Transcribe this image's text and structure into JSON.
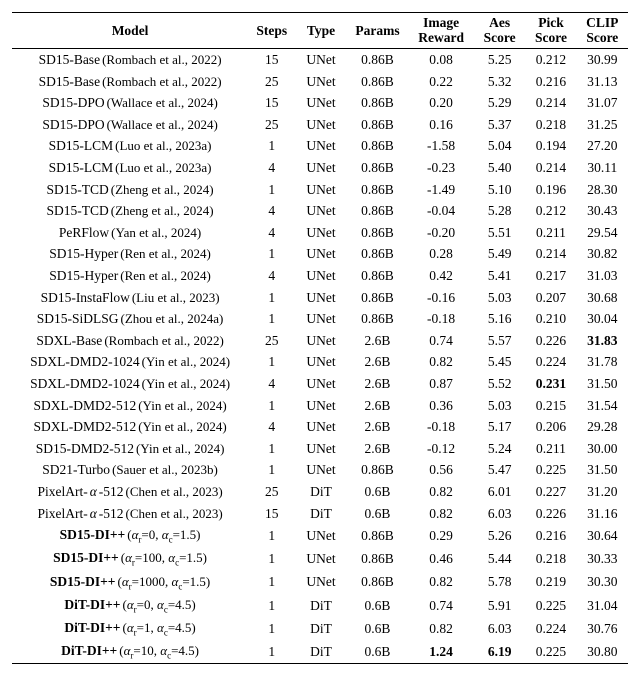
{
  "chart_data": {
    "type": "table",
    "columns": [
      "Model",
      "Steps",
      "Type",
      "Params",
      "Image Reward",
      "Aes Score",
      "Pick Score",
      "CLIP Score"
    ],
    "rows": [
      {
        "model": "SD15-Base",
        "cite": "(Rombach et al., 2022)",
        "steps": "15",
        "arch": "UNet",
        "params": "0.86B",
        "ir": "0.08",
        "aes": "5.25",
        "pick": "0.212",
        "clip": "30.99"
      },
      {
        "model": "SD15-Base",
        "cite": "(Rombach et al., 2022)",
        "steps": "25",
        "arch": "UNet",
        "params": "0.86B",
        "ir": "0.22",
        "aes": "5.32",
        "pick": "0.216",
        "clip": "31.13"
      },
      {
        "model": "SD15-DPO",
        "cite": "(Wallace et al., 2024)",
        "steps": "15",
        "arch": "UNet",
        "params": "0.86B",
        "ir": "0.20",
        "aes": "5.29",
        "pick": "0.214",
        "clip": "31.07"
      },
      {
        "model": "SD15-DPO",
        "cite": "(Wallace et al., 2024)",
        "steps": "25",
        "arch": "UNet",
        "params": "0.86B",
        "ir": "0.16",
        "aes": "5.37",
        "pick": "0.218",
        "clip": "31.25"
      },
      {
        "model": "SD15-LCM",
        "cite": "(Luo et al., 2023a)",
        "steps": "1",
        "arch": "UNet",
        "params": "0.86B",
        "ir": "-1.58",
        "aes": "5.04",
        "pick": "0.194",
        "clip": "27.20"
      },
      {
        "model": "SD15-LCM",
        "cite": "(Luo et al., 2023a)",
        "steps": "4",
        "arch": "UNet",
        "params": "0.86B",
        "ir": "-0.23",
        "aes": "5.40",
        "pick": "0.214",
        "clip": "30.11"
      },
      {
        "model": "SD15-TCD",
        "cite": "(Zheng et al., 2024)",
        "steps": "1",
        "arch": "UNet",
        "params": "0.86B",
        "ir": "-1.49",
        "aes": "5.10",
        "pick": "0.196",
        "clip": "28.30"
      },
      {
        "model": "SD15-TCD",
        "cite": "(Zheng et al., 2024)",
        "steps": "4",
        "arch": "UNet",
        "params": "0.86B",
        "ir": "-0.04",
        "aes": "5.28",
        "pick": "0.212",
        "clip": "30.43"
      },
      {
        "model": "PeRFlow",
        "cite": "(Yan et al., 2024)",
        "steps": "4",
        "arch": "UNet",
        "params": "0.86B",
        "ir": "-0.20",
        "aes": "5.51",
        "pick": "0.211",
        "clip": "29.54"
      },
      {
        "model": "SD15-Hyper",
        "cite": "(Ren et al., 2024)",
        "steps": "1",
        "arch": "UNet",
        "params": "0.86B",
        "ir": "0.28",
        "aes": "5.49",
        "pick": "0.214",
        "clip": "30.82"
      },
      {
        "model": "SD15-Hyper",
        "cite": "(Ren et al., 2024)",
        "steps": "4",
        "arch": "UNet",
        "params": "0.86B",
        "ir": "0.42",
        "aes": "5.41",
        "pick": "0.217",
        "clip": "31.03"
      },
      {
        "model": "SD15-InstaFlow",
        "cite": "(Liu et al., 2023)",
        "steps": "1",
        "arch": "UNet",
        "params": "0.86B",
        "ir": "-0.16",
        "aes": "5.03",
        "pick": "0.207",
        "clip": "30.68"
      },
      {
        "model": "SD15-SiDLSG",
        "cite": "(Zhou et al., 2024a)",
        "steps": "1",
        "arch": "UNet",
        "params": "0.86B",
        "ir": "-0.18",
        "aes": "5.16",
        "pick": "0.210",
        "clip": "30.04"
      },
      {
        "model": "SDXL-Base",
        "cite": "(Rombach et al., 2022)",
        "steps": "25",
        "arch": "UNet",
        "params": "2.6B",
        "ir": "0.74",
        "aes": "5.57",
        "pick": "0.226",
        "clip": "31.83",
        "bold_clip": true
      },
      {
        "model": "SDXL-DMD2-1024",
        "cite": "(Yin et al., 2024)",
        "steps": "1",
        "arch": "UNet",
        "params": "2.6B",
        "ir": "0.82",
        "aes": "5.45",
        "pick": "0.224",
        "clip": "31.78"
      },
      {
        "model": "SDXL-DMD2-1024",
        "cite": "(Yin et al., 2024)",
        "steps": "4",
        "arch": "UNet",
        "params": "2.6B",
        "ir": "0.87",
        "aes": "5.52",
        "pick": "0.231",
        "clip": "31.50",
        "bold_pick": true
      },
      {
        "model": "SDXL-DMD2-512",
        "cite": "(Yin et al., 2024)",
        "steps": "1",
        "arch": "UNet",
        "params": "2.6B",
        "ir": "0.36",
        "aes": "5.03",
        "pick": "0.215",
        "clip": "31.54"
      },
      {
        "model": "SDXL-DMD2-512",
        "cite": "(Yin et al., 2024)",
        "steps": "4",
        "arch": "UNet",
        "params": "2.6B",
        "ir": "-0.18",
        "aes": "5.17",
        "pick": "0.206",
        "clip": "29.28"
      },
      {
        "model": "SD15-DMD2-512",
        "cite": "(Yin et al., 2024)",
        "steps": "1",
        "arch": "UNet",
        "params": "2.6B",
        "ir": "-0.12",
        "aes": "5.24",
        "pick": "0.211",
        "clip": "30.00"
      },
      {
        "model": "SD21-Turbo",
        "cite": "(Sauer et al., 2023b)",
        "steps": "1",
        "arch": "UNet",
        "params": "0.86B",
        "ir": "0.56",
        "aes": "5.47",
        "pick": "0.225",
        "clip": "31.50"
      },
      {
        "model": "PixelArt-α-512",
        "cite": "(Chen et al., 2023)",
        "alpha": true,
        "steps": "25",
        "arch": "DiT",
        "params": "0.6B",
        "ir": "0.82",
        "aes": "6.01",
        "pick": "0.227",
        "clip": "31.20"
      },
      {
        "model": "PixelArt-α-512",
        "cite": "(Chen et al., 2023)",
        "alpha": true,
        "steps": "15",
        "arch": "DiT",
        "params": "0.6B",
        "ir": "0.82",
        "aes": "6.03",
        "pick": "0.226",
        "clip": "31.16"
      },
      {
        "model": "SD15-DI++",
        "bold_model": true,
        "alpha_r": "0",
        "alpha_c": "1.5",
        "steps": "1",
        "arch": "UNet",
        "params": "0.86B",
        "ir": "0.29",
        "aes": "5.26",
        "pick": "0.216",
        "clip": "30.64"
      },
      {
        "model": "SD15-DI++",
        "bold_model": true,
        "alpha_r": "100",
        "alpha_c": "1.5",
        "steps": "1",
        "arch": "UNet",
        "params": "0.86B",
        "ir": "0.46",
        "aes": "5.44",
        "pick": "0.218",
        "clip": "30.33"
      },
      {
        "model": "SD15-DI++",
        "bold_model": true,
        "alpha_r": "1000",
        "alpha_c": "1.5",
        "steps": "1",
        "arch": "UNet",
        "params": "0.86B",
        "ir": "0.82",
        "aes": "5.78",
        "pick": "0.219",
        "clip": "30.30"
      },
      {
        "model": "DiT-DI++",
        "bold_model": true,
        "alpha_r": "0",
        "alpha_c": "4.5",
        "steps": "1",
        "arch": "DiT",
        "params": "0.6B",
        "ir": "0.74",
        "aes": "5.91",
        "pick": "0.225",
        "clip": "31.04"
      },
      {
        "model": "DiT-DI++",
        "bold_model": true,
        "alpha_r": "1",
        "alpha_c": "4.5",
        "steps": "1",
        "arch": "DiT",
        "params": "0.6B",
        "ir": "0.82",
        "aes": "6.03",
        "pick": "0.224",
        "clip": "30.76"
      },
      {
        "model": "DiT-DI++",
        "bold_model": true,
        "alpha_r": "10",
        "alpha_c": "4.5",
        "steps": "1",
        "arch": "DiT",
        "params": "0.6B",
        "ir": "1.24",
        "aes": "6.19",
        "pick": "0.225",
        "clip": "30.80",
        "bold_ir": true,
        "bold_aes": true
      }
    ]
  },
  "headers": {
    "model": "Model",
    "steps": "Steps",
    "type": "Type",
    "params": "Params",
    "ir1": "Image",
    "ir2": "Reward",
    "aes1": "Aes",
    "aes2": "Score",
    "pick1": "Pick",
    "pick2": "Score",
    "clip1": "CLIP",
    "clip2": "Score"
  }
}
